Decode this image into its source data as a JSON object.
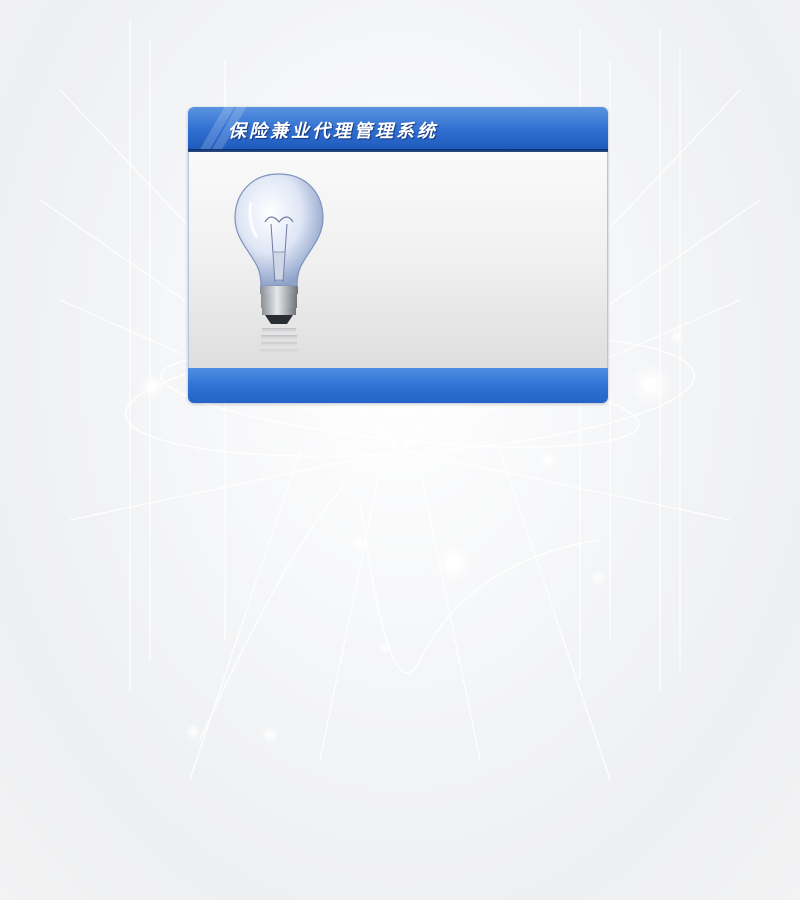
{
  "app": {
    "title": "保险兼业代理管理系统"
  },
  "colors": {
    "header_blue": "#2f6fd0",
    "footer_blue": "#2f72d4",
    "page_background": "#f2f3f5"
  },
  "icons": {
    "illustration": "light-bulb-icon"
  }
}
